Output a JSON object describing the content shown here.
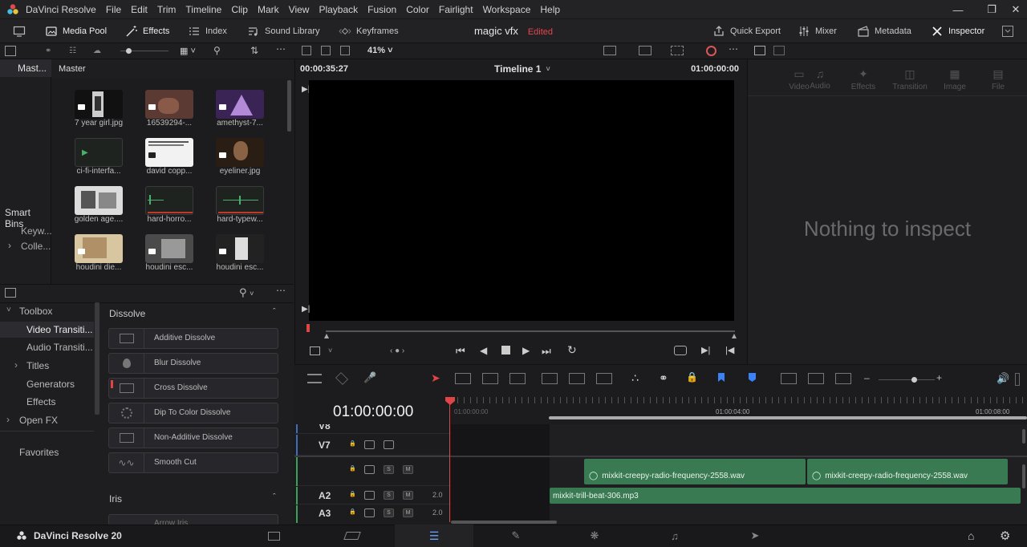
{
  "app": {
    "title": "DaVinci Resolve",
    "menu": [
      "File",
      "Edit",
      "Trim",
      "Timeline",
      "Clip",
      "Mark",
      "View",
      "Playback",
      "Fusion",
      "Color",
      "Fairlight",
      "Workspace",
      "Help"
    ]
  },
  "toolbar": {
    "media_pool": "Media Pool",
    "effects": "Effects",
    "index": "Index",
    "sound_library": "Sound Library",
    "keyframes": "Keyframes",
    "project_name": "magic vfx",
    "edited_status": "Edited",
    "quick_export": "Quick Export",
    "mixer": "Mixer",
    "metadata": "Metadata",
    "inspector": "Inspector"
  },
  "subbar": {
    "zoom": "41%"
  },
  "bins": {
    "master_short": "Mast...",
    "smart_bins": "Smart Bins",
    "keywords": "Keyw...",
    "collections": "Colle..."
  },
  "media": {
    "header": "Master",
    "items": [
      {
        "label": "7 year girl.jpg"
      },
      {
        "label": "16539294-..."
      },
      {
        "label": "amethyst-7..."
      },
      {
        "label": "ci-fi-interfa..."
      },
      {
        "label": "david copp..."
      },
      {
        "label": "eyeliner.jpg"
      },
      {
        "label": "golden age...."
      },
      {
        "label": "hard-horro..."
      },
      {
        "label": "hard-typew..."
      },
      {
        "label": "houdini die..."
      },
      {
        "label": "houdini esc..."
      },
      {
        "label": "houdini esc..."
      }
    ]
  },
  "viewer": {
    "timecode_left": "00:00:35:27",
    "timeline_name": "Timeline 1",
    "timecode_right": "01:00:00:00"
  },
  "inspector": {
    "tabs": [
      "Video",
      "Audio",
      "Effects",
      "Transition",
      "Image",
      "File"
    ],
    "empty_message": "Nothing to inspect"
  },
  "effects": {
    "tree": [
      "Toolbox",
      "Video Transiti...",
      "Audio Transiti...",
      "Titles",
      "Generators",
      "Effects",
      "Open FX",
      "Favorites"
    ],
    "category": "Dissolve",
    "items": [
      "Additive Dissolve",
      "Blur Dissolve",
      "Cross Dissolve",
      "Dip To Color Dissolve",
      "Non-Additive Dissolve",
      "Smooth Cut"
    ],
    "category2": "Iris",
    "item2": "Arrow Iris"
  },
  "timeline": {
    "timecode": "01:00:00:00",
    "ruler": [
      "01:00:00:00",
      "01:00:04:00",
      "01:00:08:00"
    ],
    "tracks": [
      {
        "name": "V8"
      },
      {
        "name": "V7"
      },
      {
        "name": "",
        "vol": ""
      },
      {
        "name": "A2",
        "vol": "2.0"
      },
      {
        "name": "A3",
        "vol": "2.0"
      }
    ],
    "clips": {
      "a1_first": "mixkit-creepy-radio-frequency-2558.wav",
      "a1_second": "mixkit-creepy-radio-frequency-2558.wav",
      "a2": "mixkit-trill-beat-306.mp3"
    }
  },
  "footer": {
    "brand": "DaVinci Resolve 20"
  }
}
